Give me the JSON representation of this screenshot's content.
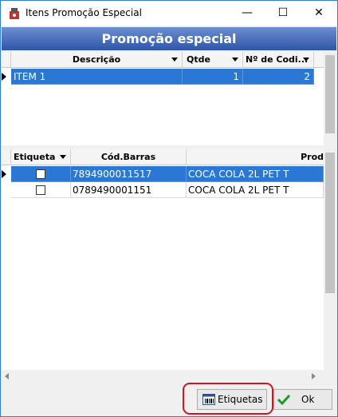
{
  "window": {
    "title": "Itens Promoção Especial",
    "minimize": "—",
    "maximize": "☐",
    "close": "✕"
  },
  "header": {
    "title": "Promoção especial"
  },
  "top_grid": {
    "columns": [
      {
        "label": "Descrição"
      },
      {
        "label": "Qtde"
      },
      {
        "label": "Nº de Codi..."
      }
    ],
    "rows": [
      {
        "descricao": "ITEM 1",
        "qtde": "1",
        "codigos": "2"
      }
    ]
  },
  "bottom_grid": {
    "columns": [
      {
        "label": "Etiqueta"
      },
      {
        "label": "Cód.Barras"
      },
      {
        "label": "Prod"
      }
    ],
    "rows": [
      {
        "barcode": "7894900011517",
        "produto": "COCA COLA 2L PET T"
      },
      {
        "barcode": "0789490001151",
        "produto": "COCA COLA 2L PET T"
      }
    ]
  },
  "buttons": {
    "etiquetas": "Etiquetas",
    "ok": "Ok"
  },
  "colors": {
    "selection": "#2b78d4",
    "header_band": "#2f56a8",
    "highlight": "#d0171f"
  }
}
